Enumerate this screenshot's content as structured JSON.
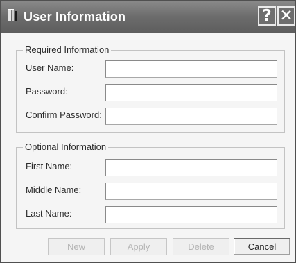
{
  "window": {
    "title": "User Information",
    "help_glyph": "?",
    "close_glyph": "✕"
  },
  "required": {
    "legend": "Required Information",
    "fields": [
      {
        "label": "User Name:",
        "value": ""
      },
      {
        "label": "Password:",
        "value": ""
      },
      {
        "label": "Confirm Password:",
        "value": ""
      }
    ]
  },
  "optional": {
    "legend": "Optional Information",
    "fields": [
      {
        "label": "First Name:",
        "value": ""
      },
      {
        "label": "Middle Name:",
        "value": ""
      },
      {
        "label": "Last Name:",
        "value": ""
      }
    ]
  },
  "buttons": {
    "new": {
      "mnemonic": "N",
      "rest": "ew",
      "enabled": false
    },
    "apply": {
      "mnemonic": "A",
      "rest": "pply",
      "enabled": false
    },
    "delete": {
      "mnemonic": "D",
      "rest": "elete",
      "enabled": false
    },
    "cancel": {
      "mnemonic": "C",
      "rest": "ancel",
      "enabled": true
    }
  },
  "icons": {
    "app": "app-icon",
    "help": "help-icon",
    "close": "close-icon"
  },
  "colors": {
    "titlebar": "#6c6c6c",
    "title_text": "#ffffff",
    "disabled_text": "#b4b4b4"
  }
}
